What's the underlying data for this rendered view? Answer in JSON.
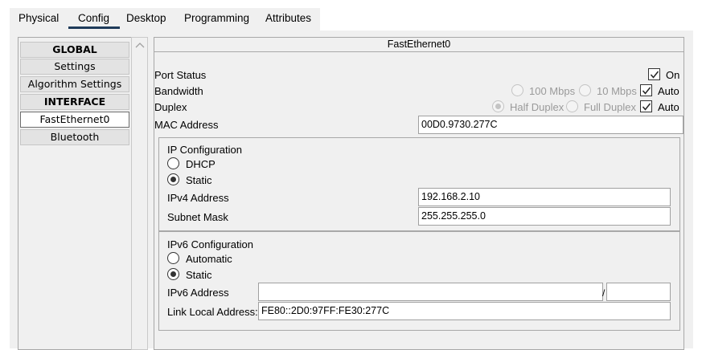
{
  "tabs": [
    "Physical",
    "Config",
    "Desktop",
    "Programming",
    "Attributes"
  ],
  "active_tab": "Config",
  "sidebar": {
    "items": [
      {
        "label": "GLOBAL",
        "header": true
      },
      {
        "label": "Settings"
      },
      {
        "label": "Algorithm Settings"
      },
      {
        "label": "INTERFACE",
        "header": true
      },
      {
        "label": "FastEthernet0",
        "selected": true
      },
      {
        "label": "Bluetooth"
      }
    ]
  },
  "panel": {
    "title": "FastEthernet0",
    "port_status": {
      "label": "Port Status",
      "checkbox_label": "On",
      "checked": true
    },
    "bandwidth": {
      "label": "Bandwidth",
      "option1": "100 Mbps",
      "option2": "10 Mbps",
      "auto_label": "Auto",
      "auto_checked": true
    },
    "duplex": {
      "label": "Duplex",
      "option1": "Half Duplex",
      "option2": "Full Duplex",
      "auto_label": "Auto",
      "auto_checked": true
    },
    "mac": {
      "label": "MAC Address",
      "value": "00D0.9730.277C"
    },
    "ipv4": {
      "title": "IP Configuration",
      "dhcp_label": "DHCP",
      "static_label": "Static",
      "selected": "Static",
      "address_label": "IPv4 Address",
      "address_value": "192.168.2.10",
      "mask_label": "Subnet Mask",
      "mask_value": "255.255.255.0"
    },
    "ipv6": {
      "title": "IPv6 Configuration",
      "auto_label": "Automatic",
      "static_label": "Static",
      "selected": "Static",
      "address_label": "IPv6 Address",
      "address_value": "",
      "prefix_sep": "/",
      "prefix_value": "",
      "link_local_label": "Link Local Address:",
      "link_local_value": "FE80::2D0:97FF:FE30:277C"
    }
  },
  "colors": {
    "tab_underline": "#1f3b5a",
    "panel_bg": "#f0f0f0"
  }
}
